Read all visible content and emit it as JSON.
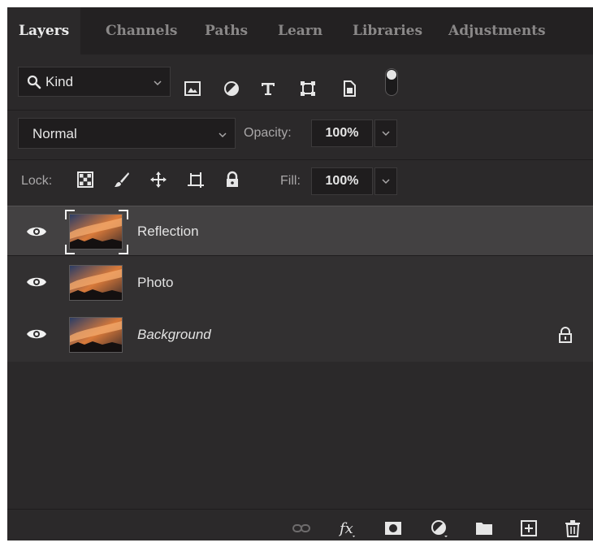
{
  "tabs": [
    "Layers",
    "Channels",
    "Paths",
    "Learn",
    "Libraries",
    "Adjustments"
  ],
  "filter": {
    "kind_label": "Kind",
    "icons": [
      "image-filter-icon",
      "adjustment-filter-icon",
      "type-filter-icon",
      "shape-filter-icon",
      "smart-object-filter-icon"
    ]
  },
  "blend": {
    "mode": "Normal",
    "opacity_label": "Opacity:",
    "opacity_value": "100%"
  },
  "lock": {
    "label": "Lock:",
    "fill_label": "Fill:",
    "fill_value": "100%",
    "icons": [
      "lock-transparent-pixels-icon",
      "lock-image-pixels-icon",
      "lock-position-icon",
      "lock-artboard-icon",
      "lock-all-icon"
    ]
  },
  "layers": [
    {
      "name": "Reflection",
      "selected": true,
      "italic": false,
      "locked": false
    },
    {
      "name": "Photo",
      "selected": false,
      "italic": false,
      "locked": false
    },
    {
      "name": "Background",
      "selected": false,
      "italic": true,
      "locked": true
    }
  ],
  "footer_icons": [
    "link-layers-icon",
    "fx-icon",
    "add-mask-icon",
    "new-adjustment-layer-icon",
    "new-group-icon",
    "new-layer-icon",
    "delete-layer-icon"
  ],
  "colors": {
    "panel_bg": "#2b292a",
    "tab_bar_bg": "#232122",
    "selected_layer_bg": "#434142",
    "text": "#e2e2e2"
  }
}
